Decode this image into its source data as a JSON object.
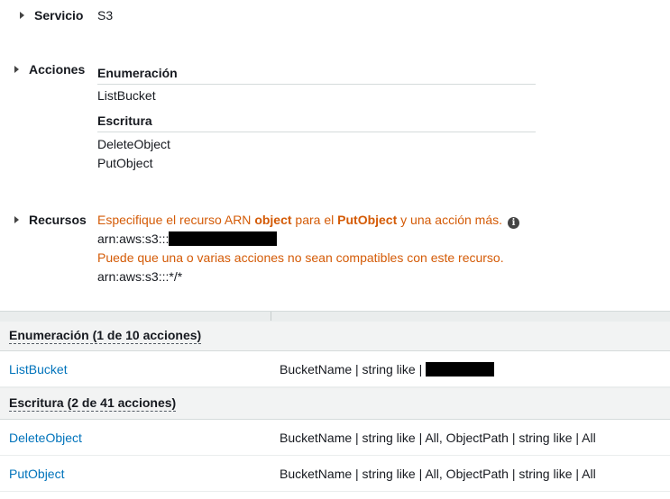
{
  "servicio": {
    "label": "Servicio",
    "value": "S3"
  },
  "acciones": {
    "label": "Acciones",
    "groups": [
      {
        "title": "Enumeración",
        "items": [
          "ListBucket"
        ]
      },
      {
        "title": "Escritura",
        "items": [
          "DeleteObject",
          "PutObject"
        ]
      }
    ]
  },
  "recursos": {
    "label": "Recursos",
    "warning_prefix": "Especifique el recurso ARN ",
    "warning_bold1": "object",
    "warning_mid": " para el ",
    "warning_bold2": "PutObject",
    "warning_suffix": " y una acción más.",
    "info_glyph": "i",
    "arn1": "arn:aws:s3:::",
    "warning2": "Puede que una o varias acciones no sean compatibles con este recurso.",
    "arn2": "arn:aws:s3:::*/*"
  },
  "table": {
    "groups": [
      {
        "title": "Enumeración (1 de 10 acciones)",
        "rows": [
          {
            "action": "ListBucket",
            "condition": "BucketName | string like | "
          }
        ]
      },
      {
        "title": "Escritura (2 de 41 acciones)",
        "rows": [
          {
            "action": "DeleteObject",
            "condition": "BucketName | string like | All, ObjectPath | string like | All"
          },
          {
            "action": "PutObject",
            "condition": "BucketName | string like | All, ObjectPath | string like | All"
          }
        ]
      }
    ]
  },
  "colors": {
    "warning": "#d45b07",
    "link": "#0073bb",
    "text": "#16191f"
  }
}
